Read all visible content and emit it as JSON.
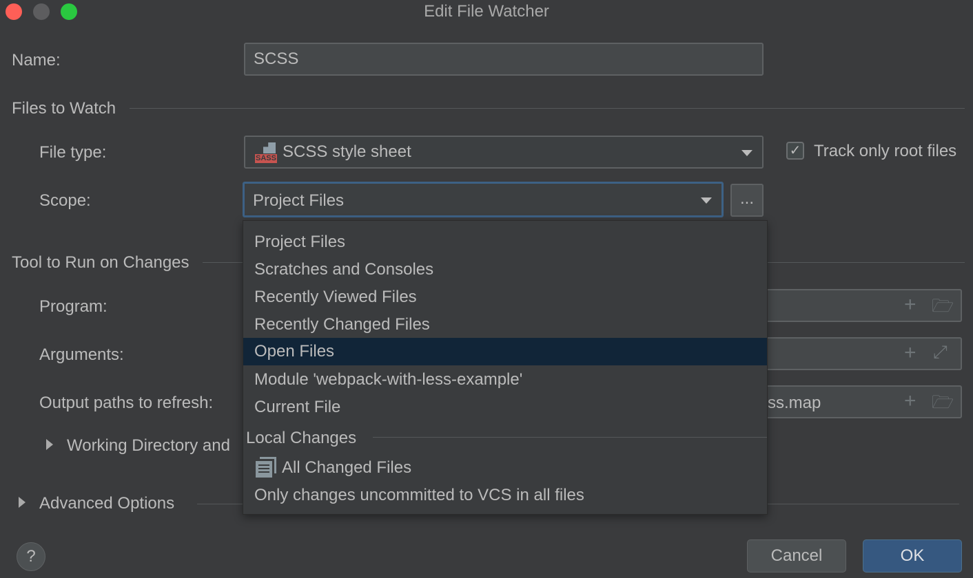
{
  "window": {
    "title": "Edit File Watcher",
    "colors": {
      "close": "#fe5f57",
      "minimize": "#5d5d5f",
      "maximize": "#2ac840"
    }
  },
  "name": {
    "label": "Name:",
    "value": "SCSS"
  },
  "files_to_watch": {
    "section": "Files to Watch",
    "file_type_label": "File type:",
    "file_type_value": "SCSS style sheet",
    "file_type_icon": "sass-file-icon",
    "file_type_icon_text": "SASS",
    "track_root_label": "Track only root files",
    "track_root_checked": true,
    "scope_label": "Scope:",
    "scope_value": "Project Files",
    "scope_more": "..."
  },
  "tool": {
    "section": "Tool to Run on Changes",
    "program_label": "Program:",
    "arguments_label": "Arguments:",
    "output_label": "Output paths to refresh:",
    "output_value_visible": "ss.map",
    "working_dir_label": "Working Directory and"
  },
  "advanced": {
    "label": "Advanced Options"
  },
  "popup": {
    "items": [
      "Project Files",
      "Scratches and Consoles",
      "Recently Viewed Files",
      "Recently Changed Files",
      "Open Files",
      "Module 'webpack-with-less-example'",
      "Current File"
    ],
    "selected": "Open Files",
    "group": "Local Changes",
    "group_items": [
      "All Changed Files",
      "Only changes uncommitted to VCS in all files"
    ]
  },
  "buttons": {
    "help": "?",
    "cancel": "Cancel",
    "ok": "OK"
  },
  "colors": {
    "accent": "#365880",
    "focus": "#3d6185",
    "selected_row": "#112538"
  }
}
